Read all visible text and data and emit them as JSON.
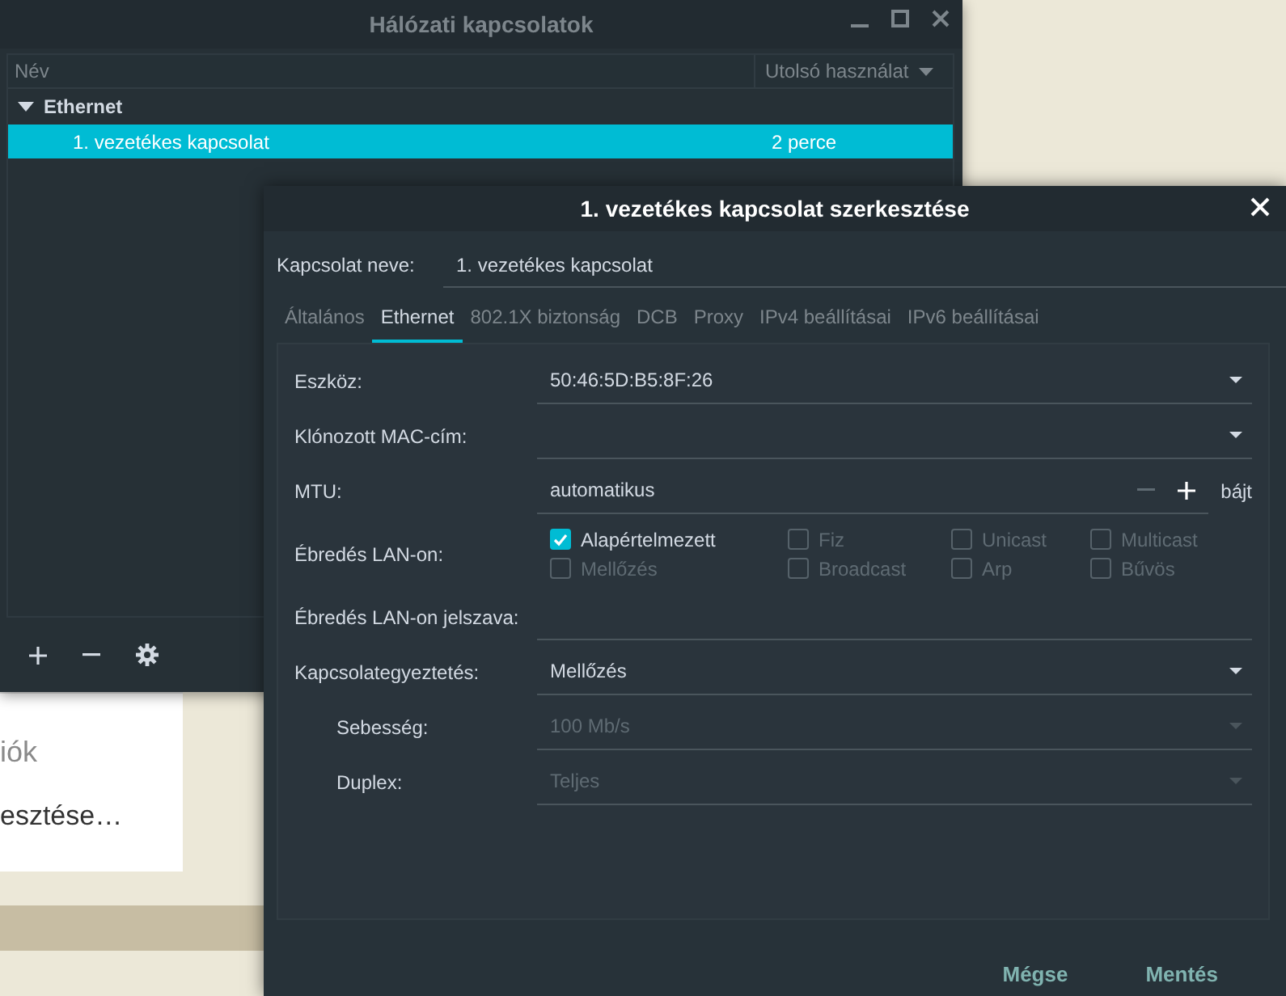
{
  "background_window": {
    "texts": [
      "iók",
      "esztése…"
    ]
  },
  "window": {
    "title": "Hálózati kapcsolatok",
    "columns": [
      "Név",
      "Utolsó használat"
    ],
    "groups": [
      {
        "name": "Ethernet",
        "expanded": true,
        "connections": [
          {
            "name": "1. vezetékes kapcsolat",
            "last_used": "2 perce",
            "selected": true
          }
        ]
      }
    ]
  },
  "dialog": {
    "title": "1. vezetékes kapcsolat szerkesztése",
    "name_label": "Kapcsolat neve:",
    "name_value": "1. vezetékes kapcsolat",
    "tabs": [
      {
        "label": "Általános",
        "selected": false
      },
      {
        "label": "Ethernet",
        "selected": true
      },
      {
        "label": "802.1X biztonság",
        "selected": false
      },
      {
        "label": "DCB",
        "selected": false
      },
      {
        "label": "Proxy",
        "selected": false
      },
      {
        "label": "IPv4 beállításai",
        "selected": false
      },
      {
        "label": "IPv6 beállításai",
        "selected": false
      }
    ],
    "fields": [
      {
        "kind": "dropdown",
        "label": "Eszköz:",
        "value": "50:46:5D:B5:8F:26",
        "disabled": false
      },
      {
        "kind": "dropdown",
        "label": "Klónozott MAC-cím:",
        "disabled": false
      },
      {
        "kind": "spin",
        "label": "MTU:",
        "value": "automatikus",
        "unit": "bájt",
        "minus_disabled": true
      },
      {
        "kind": "checks",
        "label": "Ébredés LAN-on:",
        "options": [
          {
            "label": "Alapértelmezett",
            "checked": true,
            "disabled": false
          },
          {
            "label": "Fiz",
            "checked": false,
            "disabled": true
          },
          {
            "label": "Unicast",
            "checked": false,
            "disabled": true
          },
          {
            "label": "Multicast",
            "checked": false,
            "disabled": true
          },
          {
            "label": "Mellőzés",
            "checked": false,
            "disabled": true
          },
          {
            "label": "Broadcast",
            "checked": false,
            "disabled": true
          },
          {
            "label": "Arp",
            "checked": false,
            "disabled": true
          },
          {
            "label": "Bűvös",
            "checked": false,
            "disabled": true
          }
        ]
      },
      {
        "kind": "text",
        "label": "Ébredés LAN-on jelszava:"
      },
      {
        "kind": "dropdown",
        "label": "Kapcsolategyeztetés:",
        "value": "Mellőzés",
        "disabled": false,
        "children": [
          {
            "kind": "dropdown",
            "label": "Sebesség:",
            "value": "100 Mb/s",
            "disabled": true
          },
          {
            "kind": "dropdown",
            "label": "Duplex:",
            "value": "Teljes",
            "disabled": true
          }
        ]
      }
    ],
    "buttons": [
      "Mégse",
      "Mentés"
    ]
  }
}
